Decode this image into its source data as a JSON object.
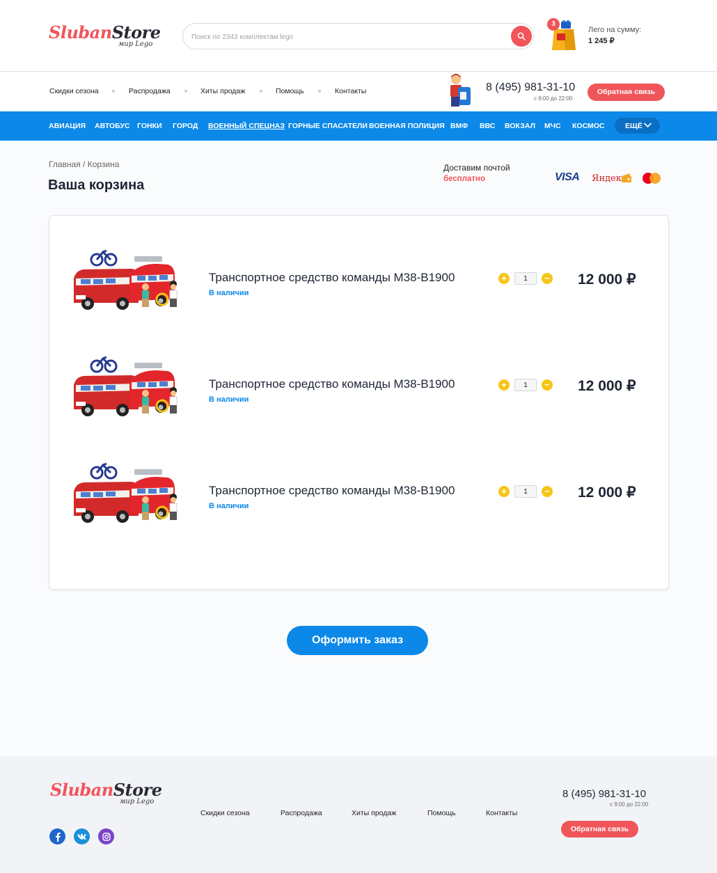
{
  "header": {
    "logo_part1": "Sluban",
    "logo_part2": "Store",
    "logo_tagline": "мир Lego",
    "search_placeholder": "Поиск по 2343 комплектам lego",
    "cart_count": "3",
    "cart_sum_label": "Лего на сумму:",
    "cart_sum_value": "1 245 ₽"
  },
  "topnav": [
    "Скидки сезона",
    "Распродажа",
    "Хиты продаж",
    "Помощь",
    "Контакты"
  ],
  "contact": {
    "phone": "8 (495) 981-31-10",
    "hours": "с 9:00 до 22:00",
    "callback_label": "Обратная связь"
  },
  "categories": [
    "АВИАЦИЯ",
    "АВТОБУС",
    "ГОНКИ",
    "ГОРОД",
    "ВОЕННЫЙ СПЕЦНАЗ",
    "ГОРНЫЕ СПАСАТЕЛИ",
    "ВОЕННАЯ ПОЛИЦИЯ",
    "ВМФ",
    "ВВС",
    "ВОКЗАЛ",
    "МЧС",
    "КОСМОС"
  ],
  "categories_active": "ВОЕННЫЙ СПЕЦНАЗ",
  "more_label": "ЕЩЁ",
  "breadcrumb": {
    "home": "Главная",
    "separator": "/",
    "current": "Корзина"
  },
  "page_title": "Ваша корзина",
  "delivery": {
    "line1": "Доставим почтой",
    "line2": "бесплатно"
  },
  "payments": {
    "visa": "VISA",
    "yandex": "Яндекс"
  },
  "cart_items": [
    {
      "name": "Транспортное средство команды M38-B1900",
      "stock": "В наличии",
      "qty": "1",
      "price": "12 000 ₽"
    },
    {
      "name": "Транспортное средство команды M38-B1900",
      "stock": "В наличии",
      "qty": "1",
      "price": "12 000 ₽"
    },
    {
      "name": "Транспортное средство команды M38-B1900",
      "stock": "В наличии",
      "qty": "1",
      "price": "12 000 ₽"
    }
  ],
  "order_button": "Оформить заказ",
  "footer": {
    "nav": [
      "Скидки сезона",
      "Распродажа",
      "Хиты продаж",
      "Помощь",
      "Контакты"
    ],
    "phone": "8 (495) 981-31-10",
    "hours": "с 9:00 до 22:00",
    "callback_label": "Обратная связь",
    "social": [
      "facebook-icon",
      "vk-icon",
      "instagram-icon"
    ]
  },
  "colors": {
    "brand_red": "#f0555a",
    "brand_blue": "#0b88e8",
    "qty_yellow": "#f6c518",
    "dark_text": "#1e2533"
  }
}
